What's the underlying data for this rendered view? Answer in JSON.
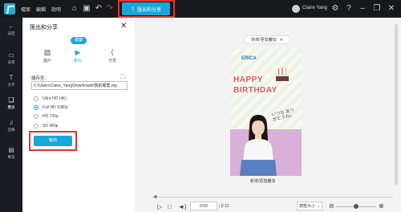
{
  "topbar": {
    "menu": [
      "檔案",
      "編輯",
      "說明"
    ],
    "export_label": "匯出和分享",
    "username": "Claire Yang"
  },
  "leftnav": {
    "items": [
      {
        "label": "返回",
        "icon": "back-arrow-icon"
      },
      {
        "label": "背景",
        "icon": "background-icon"
      },
      {
        "label": "文字",
        "icon": "text-icon"
      },
      {
        "label": "疊加",
        "icon": "overlay-icon"
      },
      {
        "label": "音樂",
        "icon": "music-icon"
      },
      {
        "label": "專案",
        "icon": "project-icon"
      }
    ]
  },
  "panel": {
    "title": "匯出和分享",
    "badge": "建議",
    "tabs": [
      {
        "label": "圖片",
        "icon": "image-icon"
      },
      {
        "label": "影片",
        "icon": "video-icon"
      },
      {
        "label": "分享",
        "icon": "share-icon"
      }
    ],
    "save_label": "儲存至：",
    "path_value": "C:\\Users\\Claire_Yang\\Downloads\\我的專案.mp",
    "resolutions": [
      "Ultra HD (4K)",
      "Full HD 1080p",
      "HD 720p",
      "SD 480p"
    ],
    "selected_resolution": "Full HD 1080p",
    "output_label": "輸出"
  },
  "canvas": {
    "chip_label": "新增/更換疊加",
    "replace_label": "新增/更換疊加",
    "card": {
      "name": "ERICA",
      "line1": "HAPPY",
      "line2": "BIRTHDAY",
      "script": "いつも ありがとうね♪"
    }
  },
  "playback": {
    "current_time": "0:00",
    "total_time": "/ 0:10",
    "fit_label": "適當大小"
  },
  "colors": {
    "accent": "#1aa7d8",
    "highlight": "#e6312f",
    "card_title": "#e05a6b",
    "card_name": "#2f6fb5"
  }
}
